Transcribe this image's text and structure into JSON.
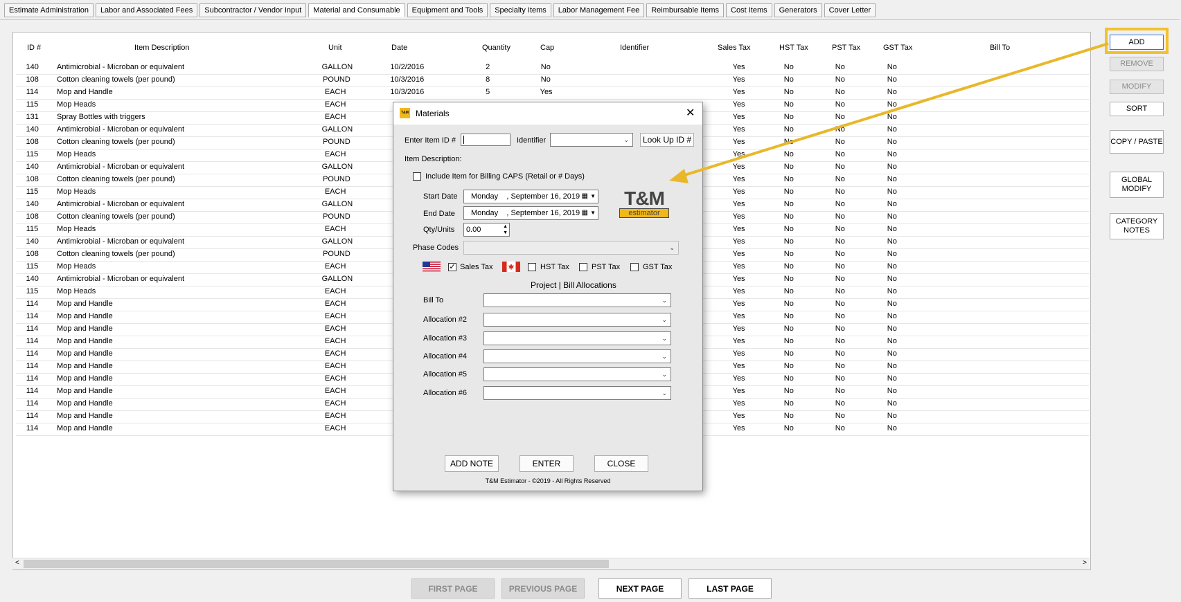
{
  "tabs": [
    "Estimate Administration",
    "Labor and Associated Fees",
    "Subcontractor / Vendor Input",
    "Material and Consumable",
    "Equipment and Tools",
    "Specialty Items",
    "Labor Management Fee",
    "Reimbursable Items",
    "Cost Items",
    "Generators",
    "Cover Letter"
  ],
  "columns": [
    "ID #",
    "Item Description",
    "Unit",
    "Date",
    "Quantity",
    "Cap",
    "Identifier",
    "Sales Tax",
    "HST Tax",
    "PST Tax",
    "GST Tax",
    "Bill To"
  ],
  "rows": [
    [
      "140",
      "Antimicrobial - Microban or equivalent",
      "GALLON",
      "10/2/2016",
      "2",
      "No",
      "",
      "Yes",
      "No",
      "No",
      "No"
    ],
    [
      "108",
      "Cotton cleaning towels (per pound)",
      "POUND",
      "10/3/2016",
      "8",
      "No",
      "",
      "Yes",
      "No",
      "No",
      "No"
    ],
    [
      "114",
      "Mop and Handle",
      "EACH",
      "10/3/2016",
      "5",
      "Yes",
      "",
      "Yes",
      "No",
      "No",
      "No"
    ],
    [
      "115",
      "Mop Heads",
      "EACH",
      "",
      "",
      "",
      "",
      "Yes",
      "No",
      "No",
      "No"
    ],
    [
      "131",
      "Spray Bottles with triggers",
      "EACH",
      "",
      "",
      "",
      "",
      "Yes",
      "No",
      "No",
      "No"
    ],
    [
      "140",
      "Antimicrobial - Microban or equivalent",
      "GALLON",
      "",
      "",
      "",
      "",
      "Yes",
      "No",
      "No",
      "No"
    ],
    [
      "108",
      "Cotton cleaning towels (per pound)",
      "POUND",
      "",
      "",
      "",
      "",
      "Yes",
      "No",
      "No",
      "No"
    ],
    [
      "115",
      "Mop Heads",
      "EACH",
      "",
      "",
      "",
      "",
      "Yes",
      "No",
      "No",
      "No"
    ],
    [
      "140",
      "Antimicrobial - Microban or equivalent",
      "GALLON",
      "",
      "",
      "",
      "",
      "Yes",
      "No",
      "No",
      "No"
    ],
    [
      "108",
      "Cotton cleaning towels (per pound)",
      "POUND",
      "",
      "",
      "",
      "",
      "Yes",
      "No",
      "No",
      "No"
    ],
    [
      "115",
      "Mop Heads",
      "EACH",
      "",
      "",
      "",
      "",
      "Yes",
      "No",
      "No",
      "No"
    ],
    [
      "140",
      "Antimicrobial - Microban or equivalent",
      "GALLON",
      "",
      "",
      "",
      "",
      "Yes",
      "No",
      "No",
      "No"
    ],
    [
      "108",
      "Cotton cleaning towels (per pound)",
      "POUND",
      "",
      "",
      "",
      "",
      "Yes",
      "No",
      "No",
      "No"
    ],
    [
      "115",
      "Mop Heads",
      "EACH",
      "",
      "",
      "",
      "",
      "Yes",
      "No",
      "No",
      "No"
    ],
    [
      "140",
      "Antimicrobial - Microban or equivalent",
      "GALLON",
      "",
      "",
      "",
      "",
      "Yes",
      "No",
      "No",
      "No"
    ],
    [
      "108",
      "Cotton cleaning towels (per pound)",
      "POUND",
      "",
      "",
      "",
      "",
      "Yes",
      "No",
      "No",
      "No"
    ],
    [
      "115",
      "Mop Heads",
      "EACH",
      "",
      "",
      "",
      "",
      "Yes",
      "No",
      "No",
      "No"
    ],
    [
      "140",
      "Antimicrobial - Microban or equivalent",
      "GALLON",
      "",
      "",
      "",
      "",
      "Yes",
      "No",
      "No",
      "No"
    ],
    [
      "115",
      "Mop Heads",
      "EACH",
      "",
      "",
      "",
      "",
      "Yes",
      "No",
      "No",
      "No"
    ],
    [
      "114",
      "Mop and Handle",
      "EACH",
      "",
      "",
      "",
      "",
      "Yes",
      "No",
      "No",
      "No"
    ],
    [
      "114",
      "Mop and Handle",
      "EACH",
      "",
      "",
      "",
      "",
      "Yes",
      "No",
      "No",
      "No"
    ],
    [
      "114",
      "Mop and Handle",
      "EACH",
      "",
      "",
      "",
      "",
      "Yes",
      "No",
      "No",
      "No"
    ],
    [
      "114",
      "Mop and Handle",
      "EACH",
      "",
      "",
      "",
      "",
      "Yes",
      "No",
      "No",
      "No"
    ],
    [
      "114",
      "Mop and Handle",
      "EACH",
      "",
      "",
      "",
      "",
      "Yes",
      "No",
      "No",
      "No"
    ],
    [
      "114",
      "Mop and Handle",
      "EACH",
      "",
      "",
      "",
      "",
      "Yes",
      "No",
      "No",
      "No"
    ],
    [
      "114",
      "Mop and Handle",
      "EACH",
      "",
      "",
      "",
      "",
      "Yes",
      "No",
      "No",
      "No"
    ],
    [
      "114",
      "Mop and Handle",
      "EACH",
      "",
      "",
      "",
      "",
      "Yes",
      "No",
      "No",
      "No"
    ],
    [
      "114",
      "Mop and Handle",
      "EACH",
      "",
      "",
      "",
      "",
      "Yes",
      "No",
      "No",
      "No"
    ],
    [
      "114",
      "Mop and Handle",
      "EACH",
      "",
      "",
      "",
      "",
      "Yes",
      "No",
      "No",
      "No"
    ],
    [
      "114",
      "Mop and Handle",
      "EACH",
      "",
      "",
      "",
      "",
      "Yes",
      "No",
      "No",
      "No"
    ]
  ],
  "side_buttons": {
    "add": "ADD",
    "remove": "REMOVE",
    "modify": "MODIFY",
    "sort": "SORT",
    "copy_paste": "COPY / PASTE",
    "global_modify": "GLOBAL MODIFY",
    "category_notes": "CATEGORY NOTES"
  },
  "nav": {
    "first": "FIRST PAGE",
    "previous": "PREVIOUS PAGE",
    "next": "NEXT PAGE",
    "last": "LAST PAGE"
  },
  "dialog": {
    "logo_text": "T&M",
    "title": "Materials",
    "enter_item_id": "Enter Item ID #",
    "identifier": "Identifier",
    "lookup": "Look Up ID #",
    "item_description": "Item Description:",
    "include_caps": "Include Item for Billing CAPS (Retail or # Days)",
    "start_date_label": "Start Date",
    "start_date_value": "Monday    , September 16, 2019",
    "end_date_label": "End Date",
    "end_date_value": "Monday    , September 16, 2019",
    "qty_label": "Qty/Units",
    "qty_value": "0.00",
    "phase_codes": "Phase Codes",
    "sales_tax": "Sales Tax",
    "hst_tax": "HST Tax",
    "pst_tax": "PST Tax",
    "gst_tax": "GST Tax",
    "sales_tax_checked": true,
    "allocations_heading": "Project | Bill Allocations",
    "bill_to": "Bill To",
    "allocations": [
      "Allocation #2",
      "Allocation #3",
      "Allocation #4",
      "Allocation #5",
      "Allocation #6"
    ],
    "add_note": "ADD NOTE",
    "enter": "ENTER",
    "close": "CLOSE",
    "footer": "T&M Estimator - ©2019 - All Rights Reserved",
    "brand_big": "T&M",
    "brand_small": "estimator"
  },
  "colors": {
    "highlight": "#f2c12e",
    "brand_yellow": "#f0b81c"
  }
}
